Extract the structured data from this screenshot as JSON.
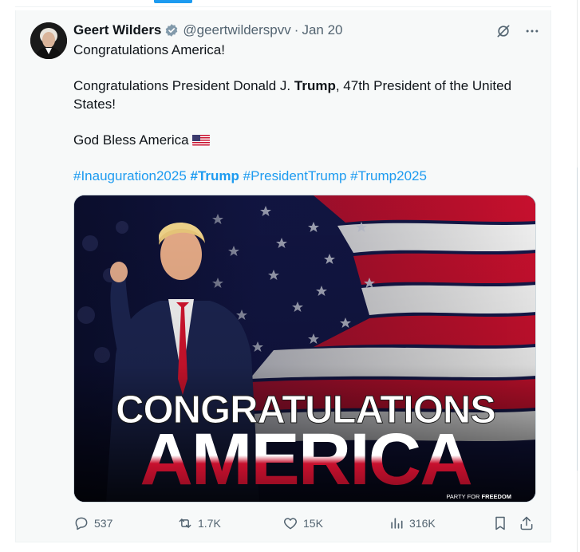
{
  "tweet": {
    "author": {
      "display_name": "Geert Wilders",
      "handle": "@geertwilderspvv",
      "date": "Jan 20",
      "verified_icon": "verified-badge-icon"
    },
    "text": {
      "line1": "Congratulations America!",
      "line2_prefix": "Congratulations President Donald J. ",
      "line2_bold": "Trump",
      "line2_suffix": ", 47th President of the United States!",
      "line3": "God Bless America"
    },
    "hashtags": [
      {
        "text": "#Inauguration2025",
        "bold": false
      },
      {
        "text": "#Trump",
        "bold": true
      },
      {
        "text": "#PresidentTrump",
        "bold": false
      },
      {
        "text": "#Trump2025",
        "bold": false
      }
    ],
    "media": {
      "headline_top": "CONGRATULATIONS",
      "headline_bottom": "AMERICA",
      "footer_prefix": "PARTY FOR ",
      "footer_bold": "FREEDOM"
    },
    "actions": {
      "replies": "537",
      "reposts": "1.7K",
      "likes": "15K",
      "views": "316K"
    }
  },
  "colors": {
    "link": "#1d9bf0",
    "muted": "#536471",
    "text": "#0f1419",
    "card_bg": "#f7f9f9"
  }
}
